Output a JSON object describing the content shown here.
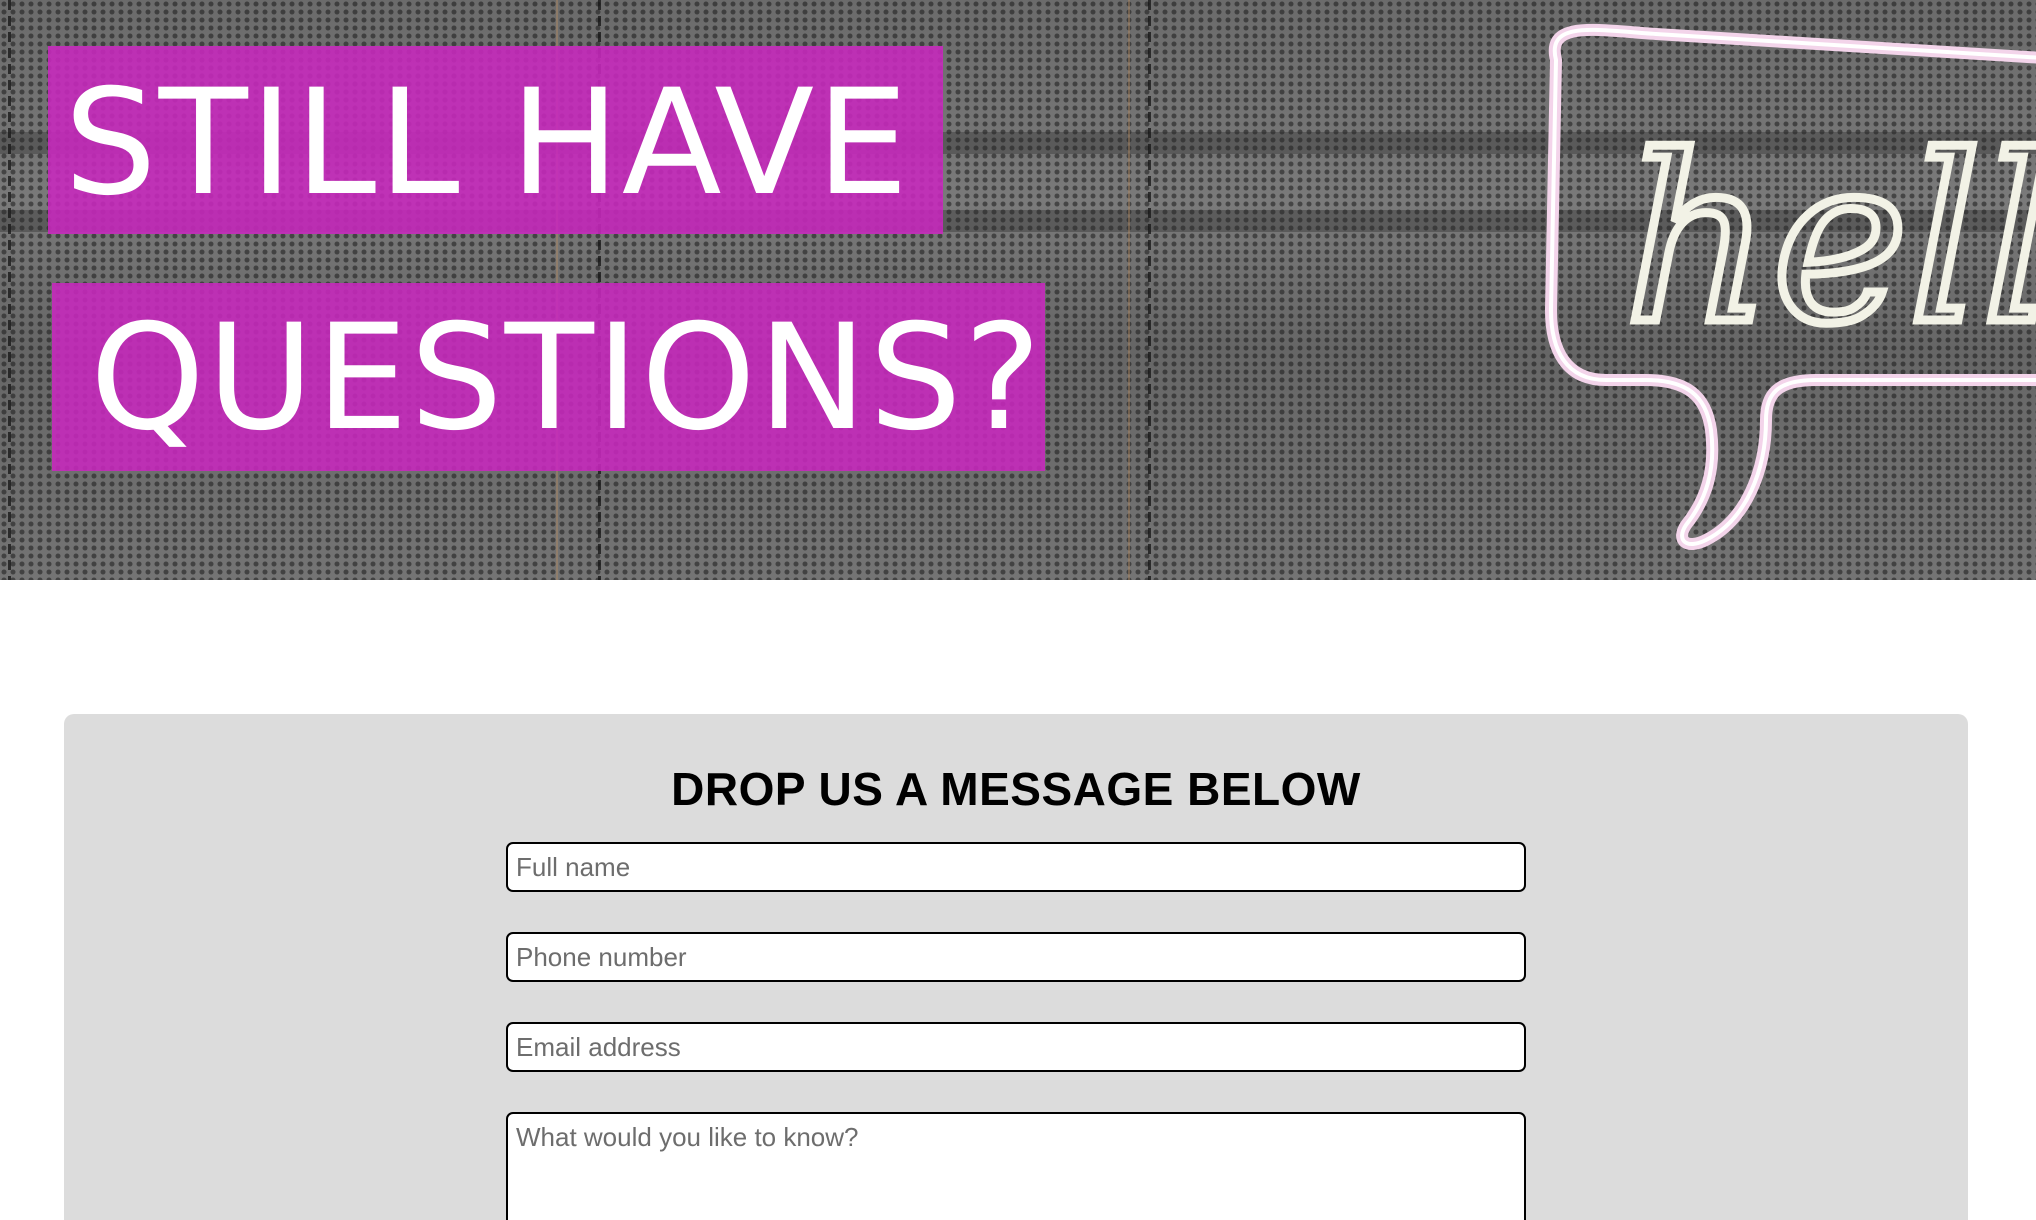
{
  "hero": {
    "title_line_1": "STILL HAVE",
    "title_line_2": "QUESTIONS?",
    "highlight_color": "#c828be",
    "neon_sign_text": "hello"
  },
  "contact_form": {
    "heading": "DROP US A MESSAGE BELOW",
    "fields": {
      "full_name_placeholder": "Full name",
      "phone_placeholder": "Phone number",
      "email_placeholder": "Email address",
      "message_placeholder": "What would you like to know?"
    }
  }
}
